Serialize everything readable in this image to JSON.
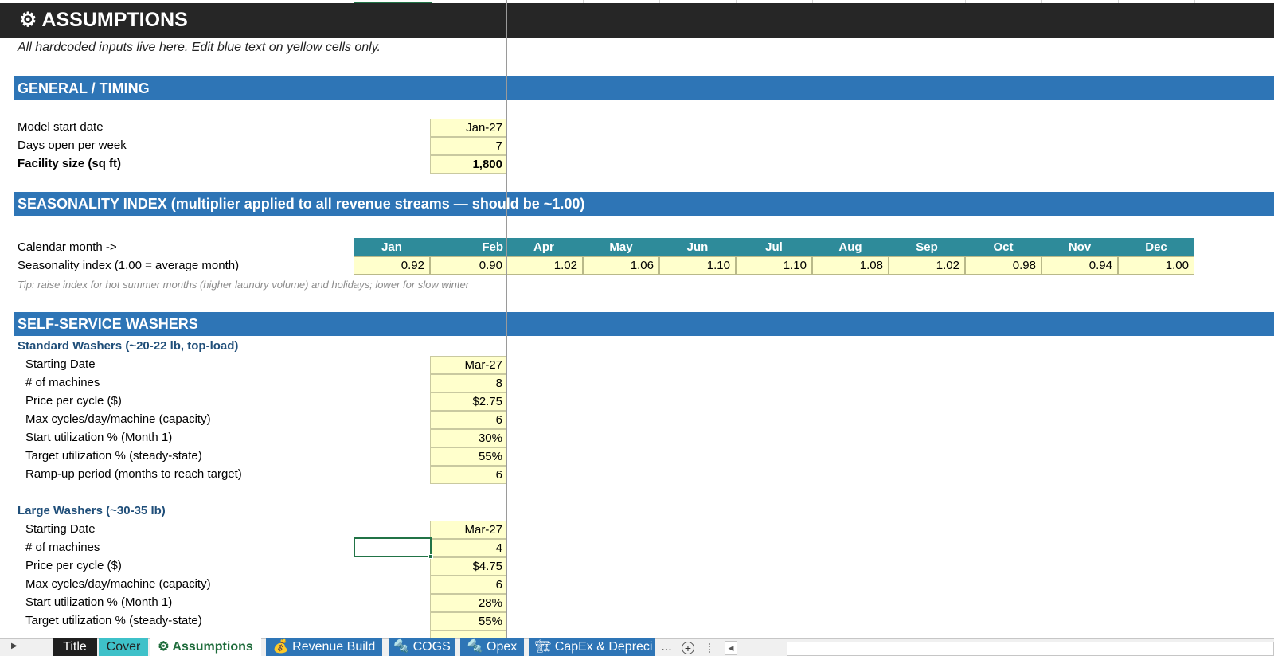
{
  "sheet": {
    "title": "⚙ ASSUMPTIONS",
    "subtitle": "All hardcoded inputs live here. Edit blue text on yellow cells only."
  },
  "general": {
    "header": "GENERAL / TIMING",
    "rows": [
      {
        "label": "Model start date",
        "value": "Jan-27"
      },
      {
        "label": "Days open per week",
        "value": "7"
      },
      {
        "label": "Facility size (sq ft)",
        "value": "1,800"
      }
    ]
  },
  "seasonality": {
    "header": "SEASONALITY INDEX  (multiplier applied to all revenue streams — should be ~1.00)",
    "month_row_label": "Calendar month ->",
    "index_row_label": "Seasonality index (1.00 = average month)",
    "months": [
      "Jan",
      "Feb",
      "Apr",
      "May",
      "Jun",
      "Jul",
      "Aug",
      "Sep",
      "Oct",
      "Nov",
      "Dec"
    ],
    "values": [
      "0.92",
      "0.90",
      "1.02",
      "1.06",
      "1.10",
      "1.10",
      "1.08",
      "1.02",
      "0.98",
      "0.94",
      "1.00"
    ],
    "tip": "Tip: raise index for hot summer months (higher laundry volume) and holidays; lower for slow winter"
  },
  "washers": {
    "header": "SELF-SERVICE WASHERS",
    "standard": {
      "title": "Standard Washers (~20-22 lb, top-load)",
      "rows": [
        {
          "label": "Starting Date",
          "value": "Mar-27"
        },
        {
          "label": "# of machines",
          "value": "8"
        },
        {
          "label": "Price per cycle ($)",
          "value": "$2.75"
        },
        {
          "label": "Max cycles/day/machine (capacity)",
          "value": "6"
        },
        {
          "label": "Start utilization % (Month 1)",
          "value": "30%"
        },
        {
          "label": "Target utilization % (steady-state)",
          "value": "55%"
        },
        {
          "label": "Ramp-up period (months to reach target)",
          "value": "6"
        }
      ]
    },
    "large": {
      "title": "Large Washers (~30-35 lb)",
      "rows": [
        {
          "label": "Starting Date",
          "value": "Mar-27"
        },
        {
          "label": "# of machines",
          "value": "4"
        },
        {
          "label": "Price per cycle ($)",
          "value": "$4.75"
        },
        {
          "label": "Max cycles/day/machine (capacity)",
          "value": "6"
        },
        {
          "label": "Start utilization % (Month 1)",
          "value": "28%"
        },
        {
          "label": "Target utilization % (steady-state)",
          "value": "55%"
        }
      ]
    }
  },
  "tabs": {
    "items": [
      {
        "label": "Title",
        "bg": "#1f1f1f",
        "fg": "#ffffff"
      },
      {
        "label": "Cover",
        "bg": "#3ec1c9",
        "fg": "#222222"
      },
      {
        "label": "⚙ Assumptions",
        "bg": "#ffffff",
        "fg": "#1d6b3a"
      },
      {
        "label": "💰 Revenue Build",
        "bg": "#2e75b6",
        "fg": "#ffffff"
      },
      {
        "label": "🔩 COGS",
        "bg": "#2e75b6",
        "fg": "#ffffff"
      },
      {
        "label": "🔩 Opex",
        "bg": "#2e75b6",
        "fg": "#ffffff"
      },
      {
        "label": "🏗 CapEx & Depreci",
        "bg": "#2e75b6",
        "fg": "#ffffff"
      }
    ],
    "more": "...",
    "add": "+",
    "nav_left": "◀",
    "nav_first": "▶"
  },
  "colors": {
    "title_bar": "#262626",
    "section_bar": "#2e75b6",
    "month_header": "#2e8b9a",
    "input_fill": "#ffffcc",
    "selection": "#217346"
  }
}
